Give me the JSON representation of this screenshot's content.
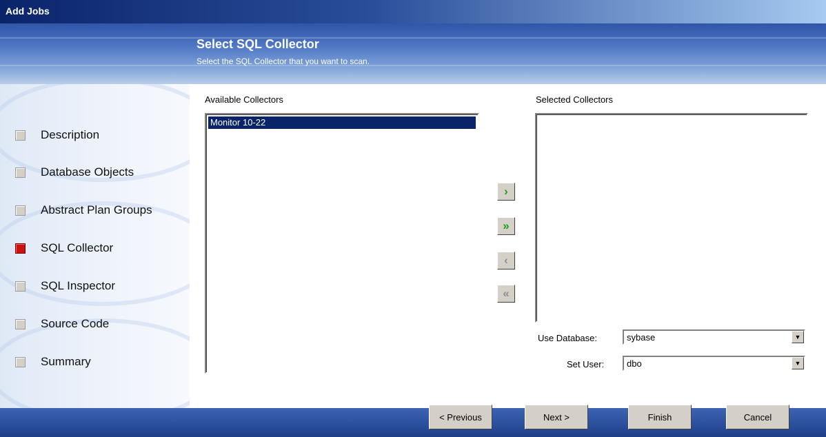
{
  "window": {
    "title": "Add Jobs"
  },
  "header": {
    "title": "Select SQL Collector",
    "subtitle": "Select the SQL Collector that you want to scan."
  },
  "steps": [
    {
      "label": "Description",
      "active": false
    },
    {
      "label": "Database Objects",
      "active": false
    },
    {
      "label": "Abstract Plan Groups",
      "active": false
    },
    {
      "label": "SQL Collector",
      "active": true
    },
    {
      "label": "SQL Inspector",
      "active": false
    },
    {
      "label": "Source Code",
      "active": false
    },
    {
      "label": "Summary",
      "active": false
    }
  ],
  "available": {
    "label": "Available Collectors",
    "items": [
      "Monitor 10-22"
    ],
    "selected": "Monitor 10-22"
  },
  "selected_list": {
    "label": "Selected Collectors",
    "items": []
  },
  "transfer": {
    "add": "›",
    "add_all": "»",
    "remove": "‹",
    "remove_all": "«"
  },
  "options": {
    "use_database_label": "Use Database:",
    "use_database_value": "sybase",
    "set_user_label": "Set User:",
    "set_user_value": "dbo"
  },
  "buttons": {
    "previous": "< Previous",
    "next": "Next >",
    "finish": "Finish",
    "cancel": "Cancel"
  },
  "colors": {
    "active_step": "#cc1111",
    "selection": "#0a246a",
    "enabled_arrow": "#19a019",
    "disabled_arrow": "#8c8c8c"
  }
}
